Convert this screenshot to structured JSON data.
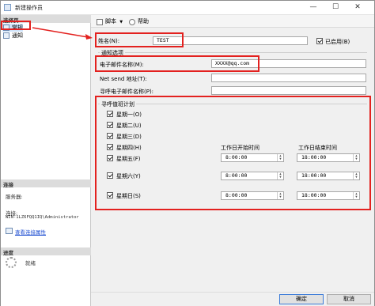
{
  "window": {
    "title": "新建操作员",
    "min": "—",
    "max": "☐",
    "close": "✕"
  },
  "left": {
    "page_header": "选择页",
    "nav": [
      {
        "label": "常规",
        "icon": "general-page-icon"
      },
      {
        "label": "通知",
        "icon": "notification-page-icon"
      }
    ],
    "connection_header": "连接",
    "server_label": "服务器:",
    "connection_label": "连接:",
    "connection_value": "WIN-1LZ6FQQ1IQ\\Administrator",
    "view_link": "查看连接属性",
    "progress_header": "进度",
    "progress_status": "就绪"
  },
  "toolbar": {
    "script_label": "脚本",
    "help_label": "帮助"
  },
  "form": {
    "name_label": "姓名(N):",
    "name_value": "TEST",
    "enabled_label": "已启用(B)",
    "notify_group": "通知选项",
    "email_label": "电子邮件名称(M):",
    "email_value": "XXXX@qq.com",
    "netsend_label": "Net send 地址(T):",
    "netsend_value": "",
    "pager_label": "寻呼电子邮件名称(P):",
    "pager_value": "",
    "schedule_group": "寻呼值班计划",
    "start_header": "工作日开始时间",
    "end_header": "工作日结束时间",
    "weekdays": [
      "星期一(O)",
      "星期二(U)",
      "星期三(D)",
      "星期四(H)",
      "星期五(F)"
    ],
    "saturday": "星期六(Y)",
    "sunday": "星期日(S)",
    "times": {
      "weekday_start": "8:00:00",
      "weekday_end": "18:00:00",
      "sat_start": "8:00:00",
      "sat_end": "18:00:00",
      "sun_start": "8:00:00",
      "sun_end": "18:00:00"
    }
  },
  "buttons": {
    "ok": "确定",
    "cancel": "取消"
  }
}
